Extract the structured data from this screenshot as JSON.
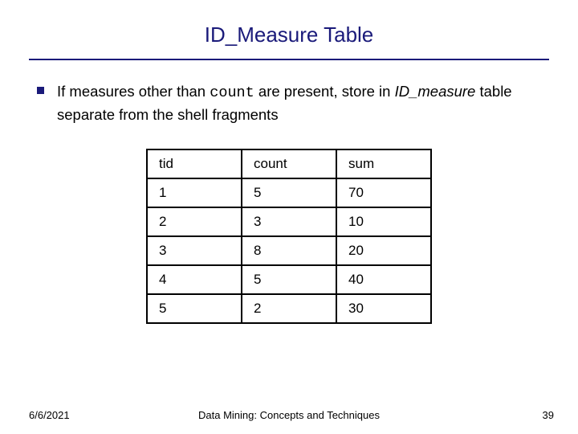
{
  "title": "ID_Measure Table",
  "bullet": {
    "prefix": "If measures other than ",
    "code": "count",
    "mid": " are present, store in ",
    "italic": "ID_measure",
    "suffix": " table separate from the shell fragments"
  },
  "table": {
    "headers": [
      "tid",
      "count",
      "sum"
    ],
    "rows": [
      [
        "1",
        "5",
        "70"
      ],
      [
        "2",
        "3",
        "10"
      ],
      [
        "3",
        "8",
        "20"
      ],
      [
        "4",
        "5",
        "40"
      ],
      [
        "5",
        "2",
        "30"
      ]
    ]
  },
  "footer": {
    "date": "6/6/2021",
    "center": "Data Mining: Concepts and Techniques",
    "page": "39"
  },
  "chart_data": {
    "type": "table",
    "title": "ID_Measure Table",
    "columns": [
      "tid",
      "count",
      "sum"
    ],
    "rows": [
      [
        1,
        5,
        70
      ],
      [
        2,
        3,
        10
      ],
      [
        3,
        8,
        20
      ],
      [
        4,
        5,
        40
      ],
      [
        5,
        2,
        30
      ]
    ]
  }
}
